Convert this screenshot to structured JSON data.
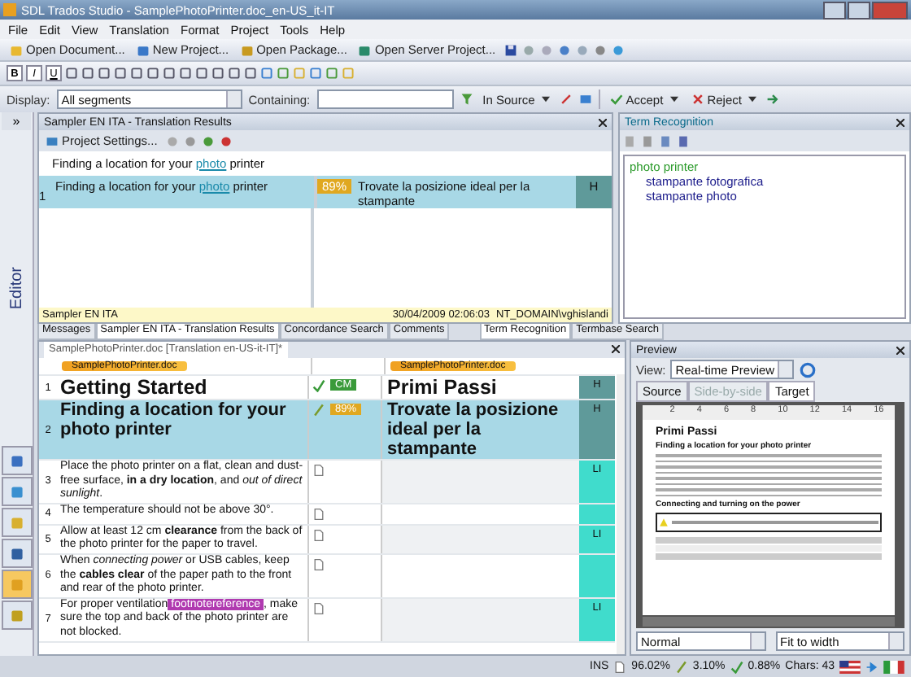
{
  "window": {
    "title": "SDL Trados Studio - SamplePhotoPrinter.doc_en-US_it-IT"
  },
  "menu": [
    "File",
    "Edit",
    "View",
    "Translation",
    "Format",
    "Project",
    "Tools",
    "Help"
  ],
  "main_toolbar": [
    "Open Document...",
    "New Project...",
    "Open Package...",
    "Open Server Project..."
  ],
  "format_toolbar": [
    "B",
    "I",
    "U"
  ],
  "filter_bar": {
    "display_label": "Display:",
    "display_value": "All segments",
    "containing_label": "Containing:",
    "in_source": "In Source",
    "accept": "Accept",
    "reject": "Reject"
  },
  "sidebar": {
    "expand": "»",
    "title": "Editor"
  },
  "translation_results": {
    "title": "Sampler EN ITA - Translation Results",
    "project_settings": "Project Settings...",
    "source_preview": {
      "before": "Finding a location for your",
      "term": "photo",
      "after": "printer"
    },
    "result": {
      "number": "1",
      "source_before": "Finding a location for your",
      "source_term": "photo",
      "source_after": "printer",
      "match": "89%",
      "target": "Trovate la posizione ideal per la stampante",
      "structure": "H"
    },
    "footer": {
      "tm": "Sampler EN ITA",
      "date": "30/04/2009 02:06:03",
      "user": "NT_DOMAIN\\vghislandi"
    }
  },
  "panel_tabs": [
    {
      "label": "Messages",
      "selected": false
    },
    {
      "label": "Sampler EN ITA - Translation Results",
      "selected": true
    },
    {
      "label": "Concordance Search",
      "selected": false
    },
    {
      "label": "Comments",
      "selected": false
    }
  ],
  "term_recognition": {
    "title": "Term Recognition",
    "terms": [
      {
        "term": "photo printer",
        "children": [
          {
            "term": "stampante fotografica"
          },
          {
            "term": "stampante photo"
          }
        ]
      }
    ],
    "tabs": [
      {
        "label": "Term Recognition",
        "selected": true
      },
      {
        "label": "Termbase Search",
        "selected": false
      }
    ]
  },
  "editor": {
    "document_tab": "SamplePhotoPrinter.doc [Translation en-US-it-IT]*",
    "source_tag": "SamplePhotoPrinter.doc",
    "target_tag": "SamplePhotoPrinter.doc",
    "segments": [
      {
        "number": "1",
        "kind": "title",
        "source": "Getting Started",
        "match": {
          "kind": "cm",
          "label": "CM"
        },
        "target": "Primi Passi",
        "structure": {
          "kind": "heading",
          "label": "H"
        },
        "selected": false
      },
      {
        "number": "2",
        "kind": "subtitle",
        "source": "Finding a location for your photo printer",
        "match": {
          "kind": "fuzzy",
          "label": "89%"
        },
        "target": "Trovate la posizione ideal per la stampante",
        "structure": {
          "kind": "heading",
          "label": "H"
        },
        "selected": true
      },
      {
        "number": "3",
        "kind": "body",
        "source": "Place the photo printer on a flat, clean and dust-free surface, **in a dry location**, and *out of direct sunlight*.",
        "match": {
          "kind": "none"
        },
        "structure": {
          "kind": "list",
          "label": "LI"
        },
        "selected": false
      },
      {
        "number": "4",
        "kind": "body",
        "source": "The temperature should not be above 30°.",
        "match": {
          "kind": "none"
        },
        "structure": {
          "kind": "list"
        },
        "selected": false
      },
      {
        "number": "5",
        "kind": "body",
        "source": "Allow at least 12 cm **clearance** from the back of the photo printer for the paper to travel.",
        "match": {
          "kind": "none"
        },
        "structure": {
          "kind": "list",
          "label": "LI"
        },
        "selected": false
      },
      {
        "number": "6",
        "kind": "body",
        "source": "When *connecting power*  or USB cables, keep the **cables clear** of the paper path to the front and rear of the photo printer.",
        "match": {
          "kind": "none"
        },
        "structure": {
          "kind": "list"
        },
        "selected": false
      },
      {
        "number": "7",
        "kind": "body",
        "source": "For proper ventilation",
        "tag": "footnotereference",
        "source_end": ", make sure the top and back of the photo printer are not blocked.",
        "match": {
          "kind": "none"
        },
        "structure": {
          "kind": "list",
          "label": "LI"
        },
        "selected": false
      }
    ]
  },
  "preview": {
    "title": "Preview",
    "view_label": "View:",
    "view_value": "Real-time Preview",
    "tabs": [
      {
        "label": "Source",
        "selected": false,
        "disabled": false
      },
      {
        "label": "Side-by-side",
        "selected": false,
        "disabled": true
      },
      {
        "label": "Target",
        "selected": true,
        "disabled": false
      }
    ],
    "ruler": [
      "2",
      "4",
      "6",
      "8",
      "10",
      "12",
      "14",
      "16"
    ],
    "doc_title": "Primi Passi",
    "doc_heading": "Finding a location for your photo printer",
    "doc_heading2": "Connecting and turning on the power",
    "style_value": "Normal",
    "zoom_value": "Fit to width"
  },
  "status_bar": {
    "mode": "INS",
    "exact": "96.02%",
    "fuzzy": "3.10%",
    "cm": "0.88%",
    "chars": "Chars: 43"
  }
}
